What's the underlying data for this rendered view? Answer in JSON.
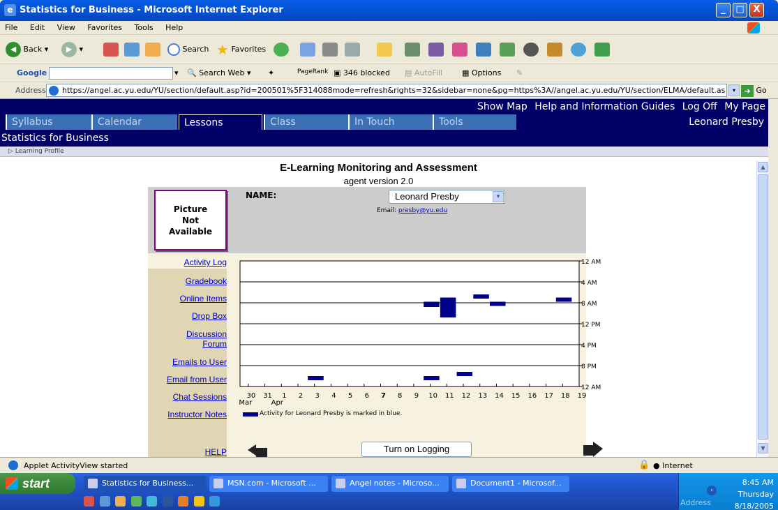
{
  "window": {
    "title": "Statistics for Business - Microsoft Internet Explorer",
    "minimize_label": "_",
    "maximize_label": "□",
    "close_label": "X"
  },
  "menu": [
    "File",
    "Edit",
    "View",
    "Favorites",
    "Tools",
    "Help"
  ],
  "toolbar": {
    "back_label": "Back",
    "search_label": "Search",
    "favorites_label": "Favorites"
  },
  "googlebar": {
    "brand": "Google",
    "search_value": "",
    "search_web_label": "Search Web",
    "pagerank_label": "PageRank",
    "blocked_label": "346 blocked",
    "autofill_label": "AutoFill",
    "options_label": "Options"
  },
  "address": {
    "label": "Address",
    "url": "https://angel.ac.yu.edu/YU/section/default.asp?id=200501%5F314088mode=refresh&rights=32&sidebar=none&pg=https%3A//angel.ac.yu.edu/YU/section/ELMA/default.as",
    "go_label": "Go"
  },
  "site": {
    "top_links": [
      "Show Map",
      "Help and Information Guides",
      "Log Off",
      "My Page"
    ],
    "tabs": [
      "Syllabus",
      "Calendar",
      "Lessons",
      "Class",
      "In Touch",
      "Tools"
    ],
    "active_tab": "Lessons",
    "user": "Leonard Presby",
    "course_title": "Statistics for Business",
    "profile_link": "▷ Learning Profile"
  },
  "elma": {
    "title": "E-Learning Monitoring and Assessment",
    "subtitle": "agent version 2.0",
    "picture_text": [
      "Picture",
      "Not",
      "Available"
    ],
    "name_label": "NAME:",
    "selected_name": "Leonard Presby",
    "email_label": "Email:",
    "email": "presby@yu.edu",
    "sidebar": [
      "Activity Log",
      "Gradebook",
      "Online Items",
      "Drop Box",
      "Discussion Forum",
      "Emails to User",
      "Email from User",
      "Chat Sessions",
      "Instructor Notes",
      "HELP"
    ],
    "legend": "Activity for Leonard Presby is marked in blue.",
    "logging_button": "Turn on Logging"
  },
  "chart_data": {
    "type": "bar",
    "x_ticks": [
      "30",
      "31",
      "1",
      "2",
      "3",
      "4",
      "5",
      "6",
      "7",
      "8",
      "9",
      "10",
      "11",
      "12",
      "13",
      "14",
      "15",
      "16",
      "17",
      "18",
      "19"
    ],
    "month_labels": [
      "Mar",
      "Apr"
    ],
    "y_ticks": [
      "12 AM",
      "4 AM",
      "8 AM",
      "12 PM",
      "4 PM",
      "8 PM",
      "12 AM"
    ],
    "ylim": [
      0,
      24
    ],
    "color": "#00008b",
    "activity": [
      {
        "day": "3",
        "start_hour": 22.0,
        "end_hour": 22.8
      },
      {
        "day": "10",
        "start_hour": 7.8,
        "end_hour": 8.8
      },
      {
        "day": "10",
        "start_hour": 22.0,
        "end_hour": 22.8
      },
      {
        "day": "11",
        "start_hour": 7.0,
        "end_hour": 10.8
      },
      {
        "day": "12",
        "start_hour": 21.2,
        "end_hour": 22.0
      },
      {
        "day": "13",
        "start_hour": 6.4,
        "end_hour": 7.2
      },
      {
        "day": "14",
        "start_hour": 7.8,
        "end_hour": 8.6
      },
      {
        "day": "18",
        "start_hour": 7.0,
        "end_hour": 7.8
      }
    ]
  },
  "statusbar": {
    "message": "Applet ActivityView started",
    "zone": "Internet"
  },
  "taskbar": {
    "start_label": "start",
    "tasks": [
      "Statistics for Business...",
      "MSN.com - Microsoft ...",
      "Angel notes - Microso...",
      "Document1 - Microsof..."
    ],
    "time": "8:45 AM",
    "day": "Thursday",
    "date": "8/18/2005",
    "address_label": "Address"
  }
}
